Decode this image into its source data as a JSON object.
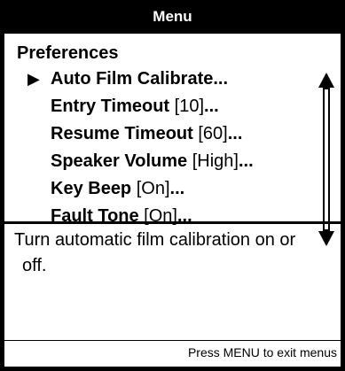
{
  "title": "Menu",
  "section": {
    "title": "Preferences"
  },
  "items": [
    {
      "label": "Auto Film Calibrate",
      "value": "",
      "ellipsis": "...",
      "selected": true
    },
    {
      "label": "Entry Timeout",
      "value": " [10]",
      "ellipsis": "...",
      "selected": false
    },
    {
      "label": "Resume Timeout",
      "value": " [60]",
      "ellipsis": "...",
      "selected": false
    },
    {
      "label": "Speaker Volume",
      "value": " [High]",
      "ellipsis": "...",
      "selected": false
    },
    {
      "label": "Key Beep",
      "value": " [On]",
      "ellipsis": "...",
      "selected": false
    },
    {
      "label": "Fault Tone",
      "value": " [On]",
      "ellipsis": "...",
      "selected": false
    }
  ],
  "pointer_glyph": "▶",
  "help": {
    "line1": "Turn automatic film calibration on or",
    "line2": "off."
  },
  "footer": {
    "hint": "Press MENU to exit menus"
  },
  "icons": {
    "scroll": "double-arrow-vertical-icon",
    "pointer": "selection-pointer-icon"
  }
}
